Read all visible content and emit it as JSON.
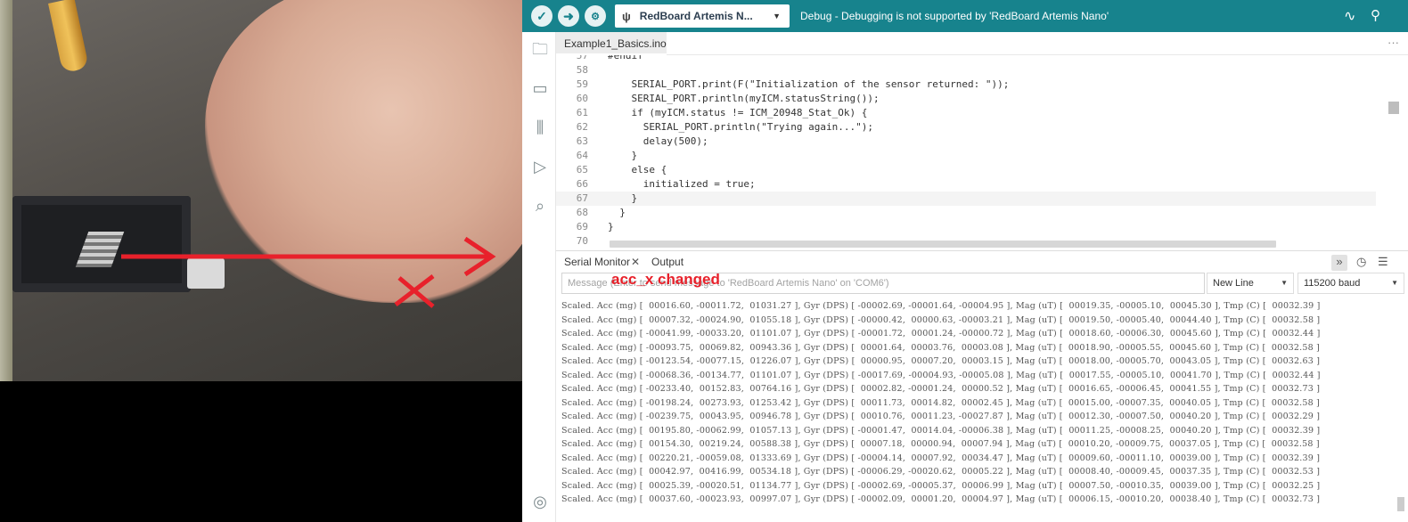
{
  "overlay": {
    "annotation_text": "acc_x changed",
    "arrow_color": "#e8212b",
    "cross_label": "x-mark"
  },
  "toolbar": {
    "verify_icon": "check-icon",
    "upload_icon": "arrow-right-icon",
    "debug_icon": "debug-icon",
    "board_name": "RedBoard Artemis N...",
    "debug_message": "Debug - Debugging is not supported by 'RedBoard Artemis Nano'",
    "accent_color": "#17838d"
  },
  "sidebar": {
    "items": [
      "folder-icon",
      "board-icon",
      "library-icon",
      "debug-run-icon",
      "search-icon"
    ],
    "footer": "account-icon"
  },
  "editor": {
    "tab_label": "Example1_Basics.ino",
    "tab_more": "···",
    "lines": [
      {
        "n": "57",
        "code": "#endif"
      },
      {
        "n": "58",
        "code": ""
      },
      {
        "n": "59",
        "code": "    SERIAL_PORT.print(F(\"Initialization of the sensor returned: \"));"
      },
      {
        "n": "60",
        "code": "    SERIAL_PORT.println(myICM.statusString());"
      },
      {
        "n": "61",
        "code": "    if (myICM.status != ICM_20948_Stat_Ok) {"
      },
      {
        "n": "62",
        "code": "      SERIAL_PORT.println(\"Trying again...\");"
      },
      {
        "n": "63",
        "code": "      delay(500);"
      },
      {
        "n": "64",
        "code": "    }"
      },
      {
        "n": "65",
        "code": "    else {"
      },
      {
        "n": "66",
        "code": "      initialized = true;"
      },
      {
        "n": "67",
        "code": "    }"
      },
      {
        "n": "68",
        "code": "  }"
      },
      {
        "n": "69",
        "code": "}"
      },
      {
        "n": "70",
        "code": ""
      }
    ]
  },
  "serial": {
    "tab_serial": "Serial Monitor",
    "tab_close": "✕",
    "tab_output": "Output",
    "input_placeholder": "Message (Enter to send message to 'RedBoard Artemis Nano' on 'COM6')",
    "line_ending": "New Line",
    "baud": "115200 baud",
    "output_lines": [
      "Scaled. Acc (mg) [  00016.60, -00011.72,  01031.27 ], Gyr (DPS) [ -00002.69, -00001.64, -00004.95 ], Mag (uT) [  00019.35, -00005.10,  00045.30 ], Tmp (C) [  00032.39 ]",
      "Scaled. Acc (mg) [  00007.32, -00024.90,  01055.18 ], Gyr (DPS) [ -00000.42,  00000.63, -00003.21 ], Mag (uT) [  00019.50, -00005.40,  00044.40 ], Tmp (C) [  00032.58 ]",
      "Scaled. Acc (mg) [ -00041.99, -00033.20,  01101.07 ], Gyr (DPS) [ -00001.72,  00001.24, -00000.72 ], Mag (uT) [  00018.60, -00006.30,  00045.60 ], Tmp (C) [  00032.44 ]",
      "Scaled. Acc (mg) [ -00093.75,  00069.82,  00943.36 ], Gyr (DPS) [  00001.64,  00003.76,  00003.08 ], Mag (uT) [  00018.90, -00005.55,  00045.60 ], Tmp (C) [  00032.58 ]",
      "Scaled. Acc (mg) [ -00123.54, -00077.15,  01226.07 ], Gyr (DPS) [  00000.95,  00007.20,  00003.15 ], Mag (uT) [  00018.00, -00005.70,  00043.05 ], Tmp (C) [  00032.63 ]",
      "Scaled. Acc (mg) [ -00068.36, -00134.77,  01101.07 ], Gyr (DPS) [ -00017.69, -00004.93, -00005.08 ], Mag (uT) [  00017.55, -00005.10,  00041.70 ], Tmp (C) [  00032.44 ]",
      "Scaled. Acc (mg) [ -00233.40,  00152.83,  00764.16 ], Gyr (DPS) [  00002.82, -00001.24,  00000.52 ], Mag (uT) [  00016.65, -00006.45,  00041.55 ], Tmp (C) [  00032.73 ]",
      "Scaled. Acc (mg) [ -00198.24,  00273.93,  01253.42 ], Gyr (DPS) [  00011.73,  00014.82,  00002.45 ], Mag (uT) [  00015.00, -00007.35,  00040.05 ], Tmp (C) [  00032.58 ]",
      "Scaled. Acc (mg) [ -00239.75,  00043.95,  00946.78 ], Gyr (DPS) [  00010.76,  00011.23, -00027.87 ], Mag (uT) [  00012.30, -00007.50,  00040.20 ], Tmp (C) [  00032.29 ]",
      "Scaled. Acc (mg) [  00195.80, -00062.99,  01057.13 ], Gyr (DPS) [ -00001.47,  00014.04, -00006.38 ], Mag (uT) [  00011.25, -00008.25,  00040.20 ], Tmp (C) [  00032.39 ]",
      "Scaled. Acc (mg) [  00154.30,  00219.24,  00588.38 ], Gyr (DPS) [  00007.18,  00000.94,  00007.94 ], Mag (uT) [  00010.20, -00009.75,  00037.05 ], Tmp (C) [  00032.58 ]",
      "Scaled. Acc (mg) [  00220.21, -00059.08,  01333.69 ], Gyr (DPS) [ -00004.14,  00007.92,  00034.47 ], Mag (uT) [  00009.60, -00011.10,  00039.00 ], Tmp (C) [  00032.39 ]",
      "Scaled. Acc (mg) [  00042.97,  00416.99,  00534.18 ], Gyr (DPS) [ -00006.29, -00020.62,  00005.22 ], Mag (uT) [  00008.40, -00009.45,  00037.35 ], Tmp (C) [  00032.53 ]",
      "Scaled. Acc (mg) [  00025.39, -00020.51,  01134.77 ], Gyr (DPS) [ -00002.69, -00005.37,  00006.99 ], Mag (uT) [  00007.50, -00010.35,  00039.00 ], Tmp (C) [  00032.25 ]",
      "Scaled. Acc (mg) [  00037.60, -00023.93,  00997.07 ], Gyr (DPS) [ -00002.09,  00001.20,  00004.97 ], Mag (uT) [  00006.15, -00010.20,  00038.40 ], Tmp (C) [  00032.73 ]"
    ]
  }
}
